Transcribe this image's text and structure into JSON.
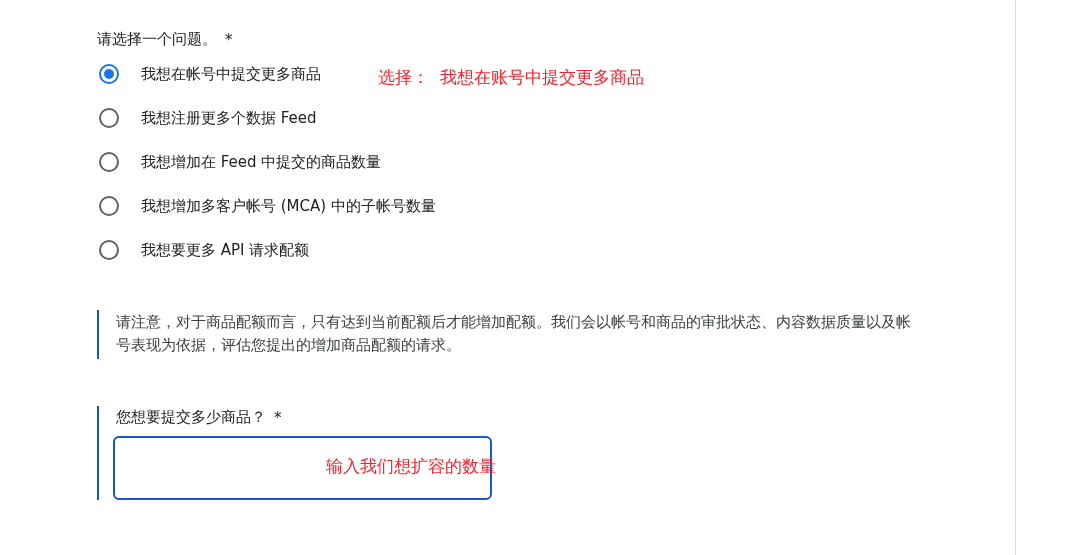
{
  "question": {
    "label": "请选择一个问题。",
    "required_mark": "*"
  },
  "options": [
    {
      "label": "我想在帐号中提交更多商品",
      "selected": true
    },
    {
      "label": "我想注册更多个数据 Feed",
      "selected": false
    },
    {
      "label": "我想增加在 Feed 中提交的商品数量",
      "selected": false
    },
    {
      "label": "我想增加多客户帐号 (MCA) 中的子帐号数量",
      "selected": false
    },
    {
      "label": "我想要更多 API 请求配额",
      "selected": false
    }
  ],
  "option_annotation": "选择：  我想在账号中提交更多商品",
  "note": "请注意，对于商品配额而言，只有达到当前配额后才能增加配额。我们会以帐号和商品的审批状态、内容数据质量以及帐号表现为依据，评估您提出的增加商品配额的请求。",
  "quantity": {
    "label": "您想要提交多少商品？",
    "required_mark": "*",
    "annotation": "输入我们想扩容的数量"
  }
}
